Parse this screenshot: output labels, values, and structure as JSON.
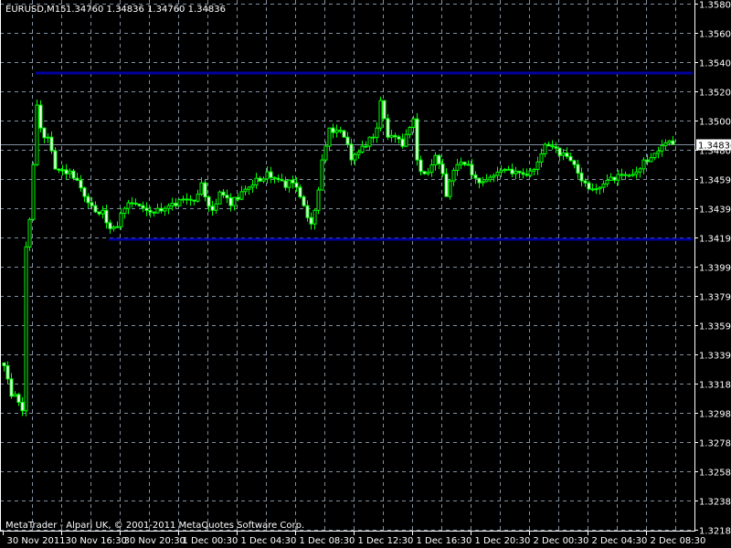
{
  "header": {
    "symbol": "EURUSD,M15",
    "ohlc": "1.34760 1.34836 1.34760 1.34836"
  },
  "footer": {
    "copyright": "MetaTrader - Alpari UK, © 2001-2011 MetaQuotes Software Corp."
  },
  "colors": {
    "background": "#000000",
    "candle": "#00ff00",
    "grid": "#8090a0",
    "hline": "#0000a0",
    "bid_line": "#8090a0",
    "axis": "#ffffff"
  },
  "chart_data": {
    "type": "candlestick",
    "symbol": "EURUSD",
    "timeframe": "M15",
    "bid": "1.34836",
    "ylim": [
      1.3218,
      1.35805
    ],
    "y_ticks": [
      "1.35805",
      "1.35605",
      "1.35405",
      "1.35200",
      "1.35000",
      "1.34800",
      "1.34595",
      "1.34395",
      "1.34195",
      "1.33990",
      "1.33790",
      "1.33590",
      "1.33390",
      "1.33185",
      "1.32985",
      "1.32785",
      "1.32580",
      "1.32380",
      "1.32180"
    ],
    "x_ticks": [
      "30 Nov 2011",
      "30 Nov 16:30",
      "30 Nov 20:30",
      "1 Dec 00:30",
      "1 Dec 04:30",
      "1 Dec 08:30",
      "1 Dec 12:30",
      "1 Dec 16:30",
      "1 Dec 20:30",
      "2 Dec 00:30",
      "2 Dec 04:30",
      "2 Dec 08:30"
    ],
    "bar_count": 184,
    "bars_per_x_tick": 16,
    "close_path": [
      [
        0,
        1.3331
      ],
      [
        2,
        1.331
      ],
      [
        4,
        1.33058
      ],
      [
        5,
        1.33
      ],
      [
        6,
        1.34129
      ],
      [
        7,
        1.34318
      ],
      [
        8,
        1.34696
      ],
      [
        9,
        1.35106
      ],
      [
        10,
        1.34948
      ],
      [
        12,
        1.34885
      ],
      [
        13,
        1.34791
      ],
      [
        14,
        1.34665
      ],
      [
        17,
        1.34633
      ],
      [
        19,
        1.34602
      ],
      [
        22,
        1.34476
      ],
      [
        24,
        1.34413
      ],
      [
        27,
        1.34381
      ],
      [
        29,
        1.34255
      ],
      [
        31,
        1.34268
      ],
      [
        33,
        1.34394
      ],
      [
        37,
        1.34413
      ],
      [
        42,
        1.34394
      ],
      [
        47,
        1.34413
      ],
      [
        52,
        1.34444
      ],
      [
        54,
        1.3457
      ],
      [
        57,
        1.34381
      ],
      [
        59,
        1.34507
      ],
      [
        62,
        1.34413
      ],
      [
        64,
        1.34457
      ],
      [
        69,
        1.34602
      ],
      [
        72,
        1.34646
      ],
      [
        74,
        1.34602
      ],
      [
        77,
        1.34539
      ],
      [
        79,
        1.3457
      ],
      [
        82,
        1.34413
      ],
      [
        84,
        1.34287
      ],
      [
        85,
        1.34381
      ],
      [
        87,
        1.34728
      ],
      [
        89,
        1.34948
      ],
      [
        90,
        1.34917
      ],
      [
        93,
        1.34885
      ],
      [
        95,
        1.34728
      ],
      [
        98,
        1.34822
      ],
      [
        100,
        1.34885
      ],
      [
        102,
        1.34948
      ],
      [
        103,
        1.35137
      ],
      [
        105,
        1.34885
      ],
      [
        109,
        1.34822
      ],
      [
        112,
        1.35011
      ],
      [
        113,
        1.34728
      ],
      [
        115,
        1.34633
      ],
      [
        118,
        1.34759
      ],
      [
        120,
        1.34633
      ],
      [
        121,
        1.34476
      ],
      [
        124,
        1.34696
      ],
      [
        127,
        1.34696
      ],
      [
        129,
        1.34602
      ],
      [
        134,
        1.34621
      ],
      [
        139,
        1.34633
      ],
      [
        144,
        1.34652
      ],
      [
        148,
        1.34835
      ],
      [
        152,
        1.34759
      ],
      [
        156,
        1.34696
      ],
      [
        159,
        1.3457
      ],
      [
        163,
        1.34539
      ],
      [
        167,
        1.34589
      ],
      [
        171,
        1.34621
      ],
      [
        175,
        1.34728
      ],
      [
        179,
        1.3479
      ],
      [
        183,
        1.34836
      ]
    ],
    "horizontal_lines": [
      {
        "price": 1.35325,
        "from_bar": 9
      },
      {
        "price": 1.3418,
        "from_bar": 29
      }
    ]
  }
}
